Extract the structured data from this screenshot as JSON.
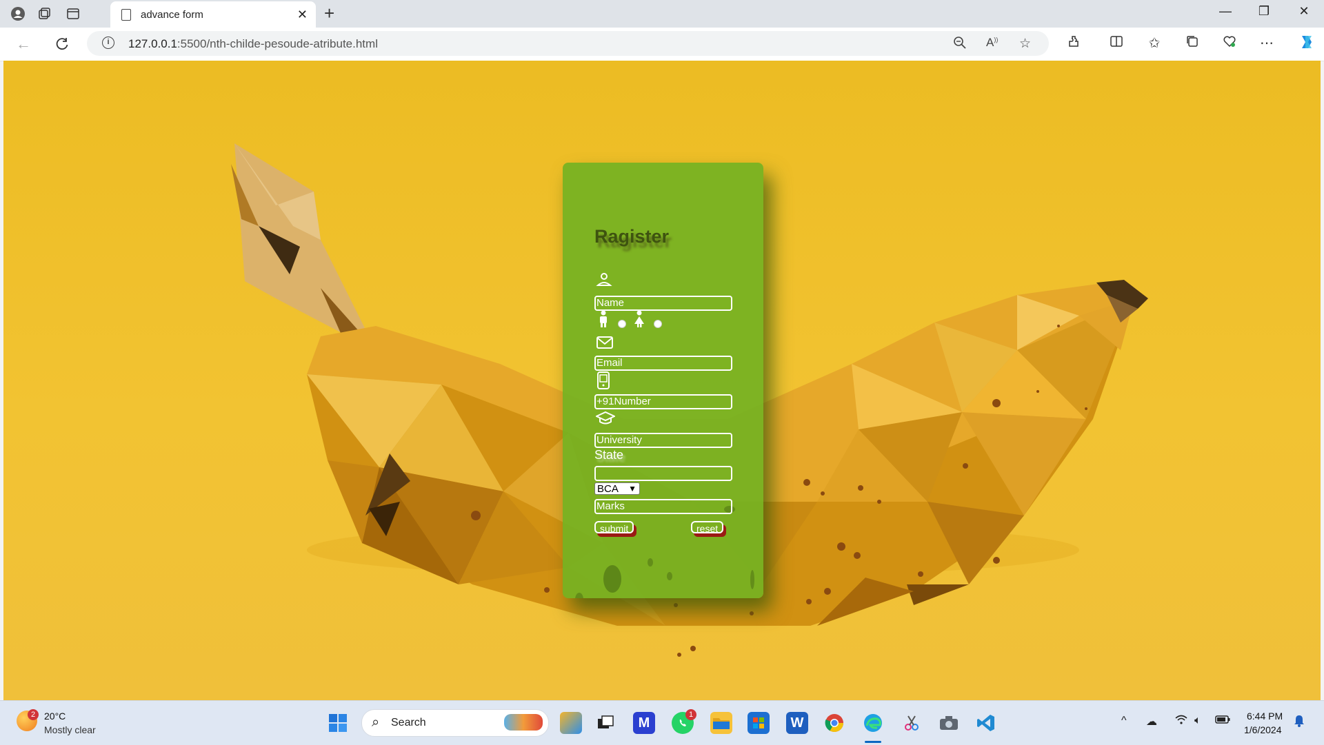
{
  "browser": {
    "tab_title": "advance form",
    "url_host": "127.0.0.1",
    "url_path": ":5500/nth-childe-pesoude-atribute.html",
    "new_tab": "+",
    "close_tab": "✕",
    "window_controls": [
      "—",
      "❐",
      "✕"
    ]
  },
  "form": {
    "title": "Ragister",
    "name_placeholder": "Name",
    "email_placeholder": "Email",
    "number_placeholder": "+91Number",
    "university_placeholder": "University",
    "state_label": "State",
    "state_value": "",
    "course_selected": "BCA",
    "marks_placeholder": "Marks",
    "submit_label": "submit",
    "reset_label": "reset"
  },
  "icons": {
    "user": "user-icon",
    "male": "male-icon",
    "female": "female-icon",
    "email": "envelope-icon",
    "phone": "phone-icon",
    "university": "graduation-cap-icon"
  },
  "taskbar": {
    "weather_temp": "20°C",
    "weather_condition": "Mostly clear",
    "weather_badge": "2",
    "search_label": "Search",
    "whatsapp_badge": "1",
    "time": "6:44 PM",
    "date": "1/6/2024"
  },
  "colors": {
    "page_background": "#f0c12e",
    "card_background": "#76b222",
    "title_color": "#3e5310",
    "button_shadow": "#9b1a14"
  }
}
